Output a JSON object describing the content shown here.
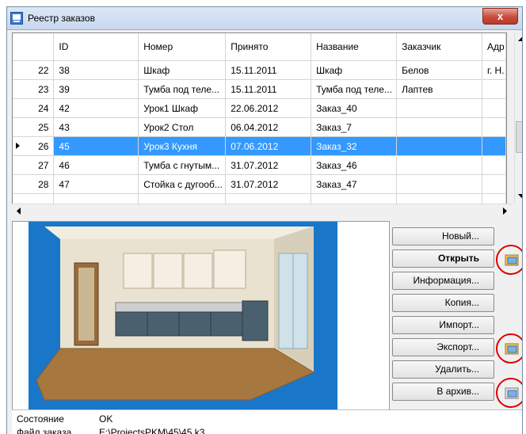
{
  "window": {
    "title": "Реестр заказов",
    "close_label": "x"
  },
  "grid": {
    "columns": [
      "ID",
      "Номер",
      "Принято",
      "Название",
      "Заказчик",
      "Адр"
    ],
    "rows": [
      {
        "rownum": "22",
        "id": "38",
        "number": "Шкаф",
        "accepted": "15.11.2011",
        "name": "Шкаф",
        "customer": "Белов",
        "address": "г. Н."
      },
      {
        "rownum": "23",
        "id": "39",
        "number": "Тумба под теле...",
        "accepted": "15.11.2011",
        "name": "Тумба под теле...",
        "customer": "Лаптев",
        "address": ""
      },
      {
        "rownum": "24",
        "id": "42",
        "number": "Урок1 Шкаф",
        "accepted": "22.06.2012",
        "name": "Заказ_40",
        "customer": "",
        "address": ""
      },
      {
        "rownum": "25",
        "id": "43",
        "number": "Урок2 Стол",
        "accepted": "06.04.2012",
        "name": "Заказ_7",
        "customer": "",
        "address": ""
      },
      {
        "rownum": "26",
        "id": "45",
        "number": "Урок3 Кухня",
        "accepted": "07.06.2012",
        "name": "Заказ_32",
        "customer": "",
        "address": ""
      },
      {
        "rownum": "27",
        "id": "46",
        "number": "Тумба с гнутым...",
        "accepted": "31.07.2012",
        "name": "Заказ_46",
        "customer": "",
        "address": ""
      },
      {
        "rownum": "28",
        "id": "47",
        "number": "Стойка с дугооб...",
        "accepted": "31.07.2012",
        "name": "Заказ_47",
        "customer": "",
        "address": ""
      }
    ],
    "selected_row": 4
  },
  "buttons": {
    "new": "Новый...",
    "open": "Открыть",
    "info": "Информация...",
    "copy": "Копия...",
    "import": "Импорт...",
    "export": "Экспорт...",
    "delete": "Удалить...",
    "archive": "В архив..."
  },
  "status": {
    "state_label": "Состояние",
    "state_value": "OK",
    "file_label": "Файл заказа",
    "file_value": "E:\\ProjectsPKM\\45\\45.k3"
  },
  "colors": {
    "selection": "#3399ff",
    "highlight_ring": "#e00000",
    "title_bar": "#c7d7ee"
  },
  "icons": {
    "app": "window-app-icon",
    "folder": "folder-open-icon",
    "row_pointer": "row-arrow-icon"
  }
}
